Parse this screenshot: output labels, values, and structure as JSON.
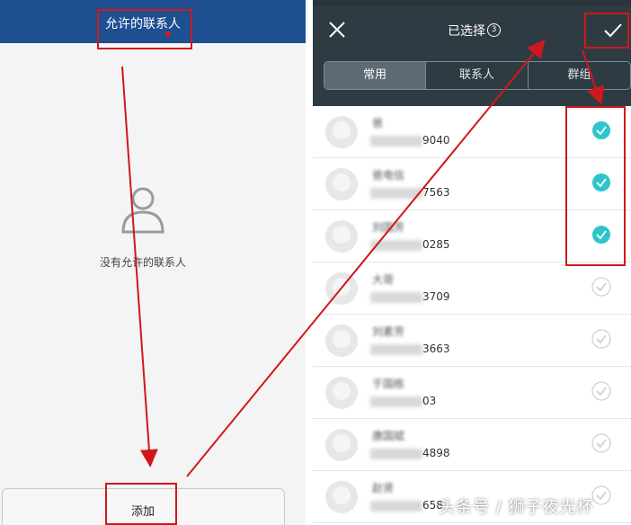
{
  "left_panel": {
    "title": "允许的联系人",
    "empty_text": "没有允许的联系人",
    "add_label": "添加"
  },
  "right_panel": {
    "title": "已选择",
    "selected_count": "3",
    "tabs": [
      {
        "label": "常用",
        "active": true
      },
      {
        "label": "联系人",
        "active": false
      },
      {
        "label": "群组",
        "active": false
      }
    ],
    "contacts": [
      {
        "name": "爸",
        "phone_tail": "9040",
        "checked": true
      },
      {
        "name": "爸电信",
        "phone_tail": "7563",
        "checked": true
      },
      {
        "name": "刘国芳",
        "phone_tail": "0285",
        "checked": true
      },
      {
        "name": "大哥",
        "phone_tail": "3709",
        "checked": false
      },
      {
        "name": "刘素芳",
        "phone_tail": "3663",
        "checked": false
      },
      {
        "name": "于国栋",
        "phone_tail": "03",
        "checked": false
      },
      {
        "name": "唐国斌",
        "phone_tail": "4898",
        "checked": false
      },
      {
        "name": "赵贤",
        "phone_tail": "658",
        "checked": false
      }
    ]
  },
  "watermark": "头条号 / 狮子夜光杯",
  "colors": {
    "left_header": "#1d4f91",
    "right_header": "#2f3b43",
    "check_selected": "#2ec5cc",
    "annotation": "#d0181c"
  },
  "icons": [
    "person-icon",
    "close-icon",
    "confirm-check-icon",
    "check-circle-icon"
  ]
}
